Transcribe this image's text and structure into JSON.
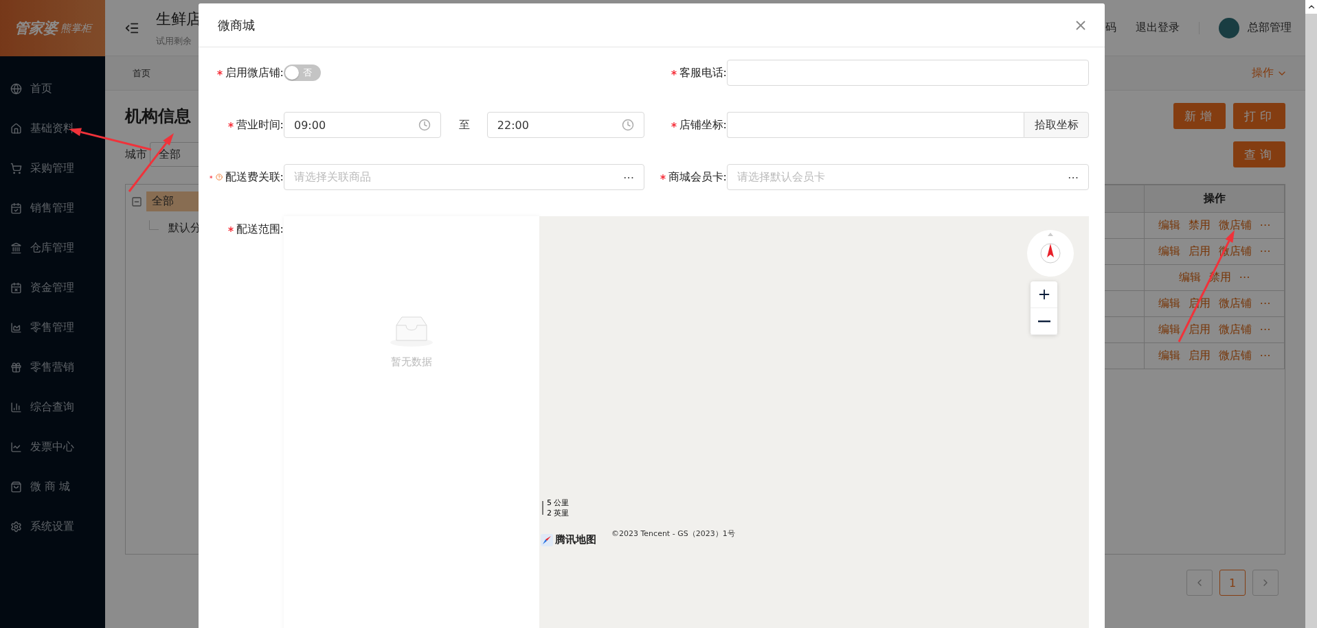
{
  "sidebar": {
    "logo": "管家婆",
    "logo_sub": "熊掌柜",
    "items": [
      {
        "label": "首页"
      },
      {
        "label": "基础资料"
      },
      {
        "label": "采购管理"
      },
      {
        "label": "销售管理"
      },
      {
        "label": "仓库管理"
      },
      {
        "label": "资金管理"
      },
      {
        "label": "零售管理"
      },
      {
        "label": "零售营销"
      },
      {
        "label": "综合查询"
      },
      {
        "label": "发票中心"
      },
      {
        "label": "微 商 城"
      },
      {
        "label": "系统设置"
      }
    ]
  },
  "header": {
    "title": "生鲜店",
    "subtitle": "试用剩余",
    "links": [
      "码",
      "退出登录"
    ],
    "user": "总部管理"
  },
  "tabs": [
    {
      "label": "首页",
      "selected": true
    }
  ],
  "actions_menu": "操作",
  "page": {
    "title": "机构信息",
    "buttons": [
      "新增",
      "打印"
    ],
    "filter": {
      "label": "城市",
      "value": "全部"
    },
    "query_button": "查询",
    "tree": [
      {
        "label": "全部",
        "selected": true,
        "expanded": true,
        "children": [
          {
            "label": "默认分",
            "selected": false
          }
        ]
      }
    ],
    "table": {
      "columns": [
        "操作"
      ],
      "rows": [
        {
          "actions": [
            "编辑",
            "禁用",
            "微店铺",
            "⋯"
          ]
        },
        {
          "actions": [
            "编辑",
            "启用",
            "微店铺",
            "⋯"
          ]
        },
        {
          "actions": [
            "编辑",
            "禁用",
            "⋯"
          ]
        },
        {
          "actions": [
            "编辑",
            "启用",
            "微店铺",
            "⋯"
          ]
        },
        {
          "actions": [
            "编辑",
            "启用",
            "微店铺",
            "⋯"
          ]
        },
        {
          "actions": [
            "编辑",
            "启用",
            "微店铺",
            "⋯"
          ]
        }
      ]
    },
    "pagination": [
      {
        "label": "1",
        "selected": true
      }
    ]
  },
  "modal": {
    "title": "微商城",
    "fields": [
      {
        "kind": "toggle",
        "label": "启用微店铺:",
        "required": true,
        "on": false,
        "text": "否"
      },
      {
        "kind": "text",
        "label": "客服电话:",
        "required": true
      },
      {
        "kind": "time_range",
        "label": "营业时间:",
        "required": true,
        "start": "09:00",
        "separator": "至",
        "end": "22:00"
      },
      {
        "kind": "text_button",
        "label": "店铺坐标:",
        "required": true,
        "button": "拾取坐标"
      },
      {
        "kind": "picker",
        "label": "配送费关联:",
        "required": true,
        "help": true,
        "placeholder": "请选择关联商品",
        "more": "⋯"
      },
      {
        "kind": "picker",
        "label": "商城会员卡:",
        "required": true,
        "placeholder": "请选择默认会员卡",
        "more": "⋯"
      },
      {
        "kind": "map",
        "label": "配送范围:",
        "required": true,
        "empty_text": "暂无数据",
        "scale_metric": "5 公里",
        "scale_imperial": "2 英里",
        "brand": "腾讯地图",
        "copyright": "©2023 Tencent - GS（2023）1号"
      }
    ]
  }
}
